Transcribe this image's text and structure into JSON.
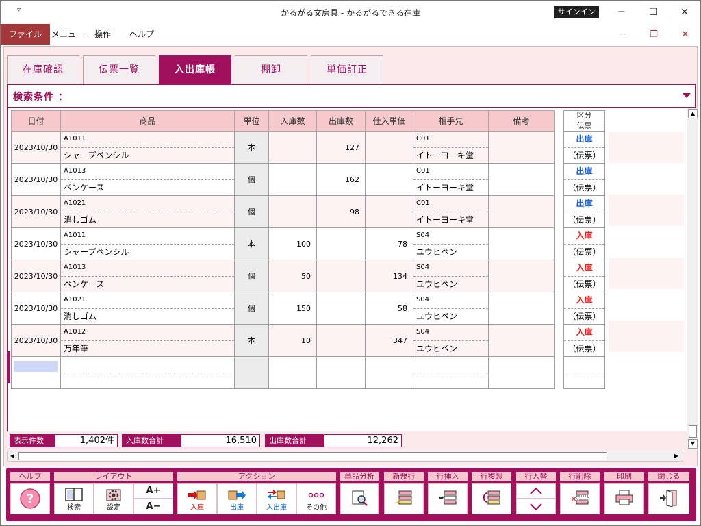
{
  "window": {
    "title": "かるがる文房具 - かるがるできる在庫",
    "signin": "サインイン",
    "min": "─",
    "max": "☐",
    "close": "✕"
  },
  "menu": {
    "items": [
      "ファイル",
      "メニュー",
      "操作",
      "ヘルプ"
    ]
  },
  "tabs": [
    "在庫確認",
    "伝票一覧",
    "入出庫帳",
    "棚卸",
    "単価訂正"
  ],
  "active_tab": "入出庫帳",
  "search": {
    "label": "検索条件 ："
  },
  "grid": {
    "columns": [
      "日付",
      "商品",
      "単位",
      "入庫数",
      "出庫数",
      "仕入単価",
      "相手先",
      "備考"
    ],
    "kbn_header_top": "区分",
    "kbn_header_bottom": "伝票",
    "rows": [
      {
        "date": "2023/10/30",
        "code": "A1011",
        "name": "シャープペンシル",
        "unit": "本",
        "in_qty": "",
        "out_qty": "127",
        "cost": "",
        "partner_code": "C01",
        "partner": "イトーヨーキ堂",
        "note": "",
        "kbn": "出庫",
        "kbn_type": "out",
        "slip": "（伝票）"
      },
      {
        "date": "2023/10/30",
        "code": "A1013",
        "name": "ペンケース",
        "unit": "個",
        "in_qty": "",
        "out_qty": "162",
        "cost": "",
        "partner_code": "C01",
        "partner": "イトーヨーキ堂",
        "note": "",
        "kbn": "出庫",
        "kbn_type": "out",
        "slip": "（伝票）"
      },
      {
        "date": "2023/10/30",
        "code": "A1021",
        "name": "消しゴム",
        "unit": "個",
        "in_qty": "",
        "out_qty": "98",
        "cost": "",
        "partner_code": "C01",
        "partner": "イトーヨーキ堂",
        "note": "",
        "kbn": "出庫",
        "kbn_type": "out",
        "slip": "（伝票）"
      },
      {
        "date": "2023/10/30",
        "code": "A1011",
        "name": "シャープペンシル",
        "unit": "本",
        "in_qty": "100",
        "out_qty": "",
        "cost": "78",
        "partner_code": "S04",
        "partner": "ユウヒペン",
        "note": "",
        "kbn": "入庫",
        "kbn_type": "in",
        "slip": "（伝票）"
      },
      {
        "date": "2023/10/30",
        "code": "A1013",
        "name": "ペンケース",
        "unit": "個",
        "in_qty": "50",
        "out_qty": "",
        "cost": "134",
        "partner_code": "S04",
        "partner": "ユウヒペン",
        "note": "",
        "kbn": "入庫",
        "kbn_type": "in",
        "slip": "（伝票）"
      },
      {
        "date": "2023/10/30",
        "code": "A1021",
        "name": "消しゴム",
        "unit": "個",
        "in_qty": "150",
        "out_qty": "",
        "cost": "58",
        "partner_code": "S04",
        "partner": "ユウヒペン",
        "note": "",
        "kbn": "入庫",
        "kbn_type": "in",
        "slip": "（伝票）"
      },
      {
        "date": "2023/10/30",
        "code": "A1012",
        "name": "万年筆",
        "unit": "本",
        "in_qty": "10",
        "out_qty": "",
        "cost": "347",
        "partner_code": "S04",
        "partner": "ユウヒペン",
        "note": "",
        "kbn": "入庫",
        "kbn_type": "in",
        "slip": "（伝票）"
      }
    ]
  },
  "totals": {
    "count_label": "表示件数",
    "count_value": "1,402件",
    "in_label": "入庫数合計",
    "in_value": "16,510",
    "out_label": "出庫数合計",
    "out_value": "12,262"
  },
  "toolbar": {
    "groups": {
      "help": "ヘルプ",
      "layout": "レイアウト",
      "action": "アクション",
      "analysis": "単品分析",
      "new_row": "新規行",
      "insert_row": "行挿入",
      "copy_row": "行複製",
      "swap_row": "行入替",
      "delete_row": "行削除",
      "print": "印刷",
      "close": "閉じる"
    },
    "buttons": {
      "search": "検索",
      "settings": "設定",
      "font_up": "A+",
      "font_down": "A−",
      "in": "入庫",
      "out": "出庫",
      "inout": "入出庫",
      "other": "その他"
    }
  },
  "colors": {
    "accent": "#a0105c",
    "header": "#f6c9cd",
    "out": "#2060c8",
    "in": "#e02020"
  }
}
